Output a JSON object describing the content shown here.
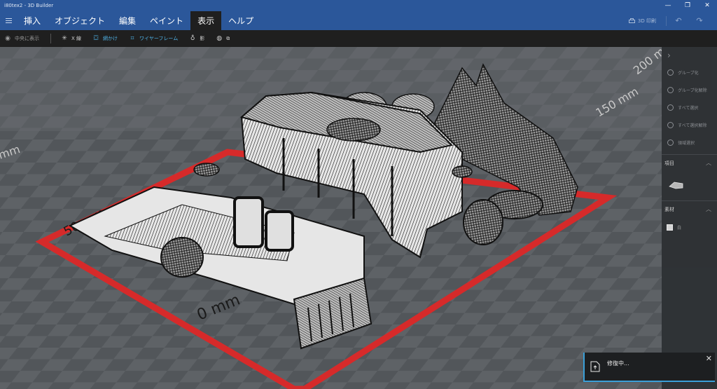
{
  "window": {
    "title": "i80tex2 - 3D Builder",
    "controls": [
      "—",
      "❐",
      "✕"
    ]
  },
  "menu": {
    "items": [
      {
        "label": "挿入",
        "active": false
      },
      {
        "label": "オブジェクト",
        "active": false
      },
      {
        "label": "編集",
        "active": false
      },
      {
        "label": "ペイント",
        "active": false
      },
      {
        "label": "表示",
        "active": true
      },
      {
        "label": "ヘルプ",
        "active": false
      }
    ],
    "print_label": "3D 印刷",
    "undo_icon": "undo-icon",
    "redo_icon": "redo-icon"
  },
  "toolbar": {
    "center_label": "中央に表示",
    "x_axis_label": "X 線",
    "shading_label": "網かけ",
    "wireframe_label": "ワイヤーフレーム",
    "light_label": "影",
    "camera_label": "⧉"
  },
  "viewport": {
    "scale_labels": [
      "200 mm",
      "150 mm",
      "0 mm",
      "mm",
      "50 mm"
    ],
    "accent": "#d62a2a"
  },
  "side_panel": {
    "actions": [
      {
        "label": "グループ化",
        "icon": "group-icon"
      },
      {
        "label": "グループ化解除",
        "icon": "ungroup-icon"
      },
      {
        "label": "すべて選択",
        "icon": "select-all-icon"
      },
      {
        "label": "すべて選択解除",
        "icon": "deselect-all-icon"
      },
      {
        "label": "領域選択",
        "icon": "region-select-icon"
      }
    ],
    "items_heading": "項目",
    "material_heading": "素材",
    "material_name": "白"
  },
  "toast": {
    "message": "修復中..."
  }
}
